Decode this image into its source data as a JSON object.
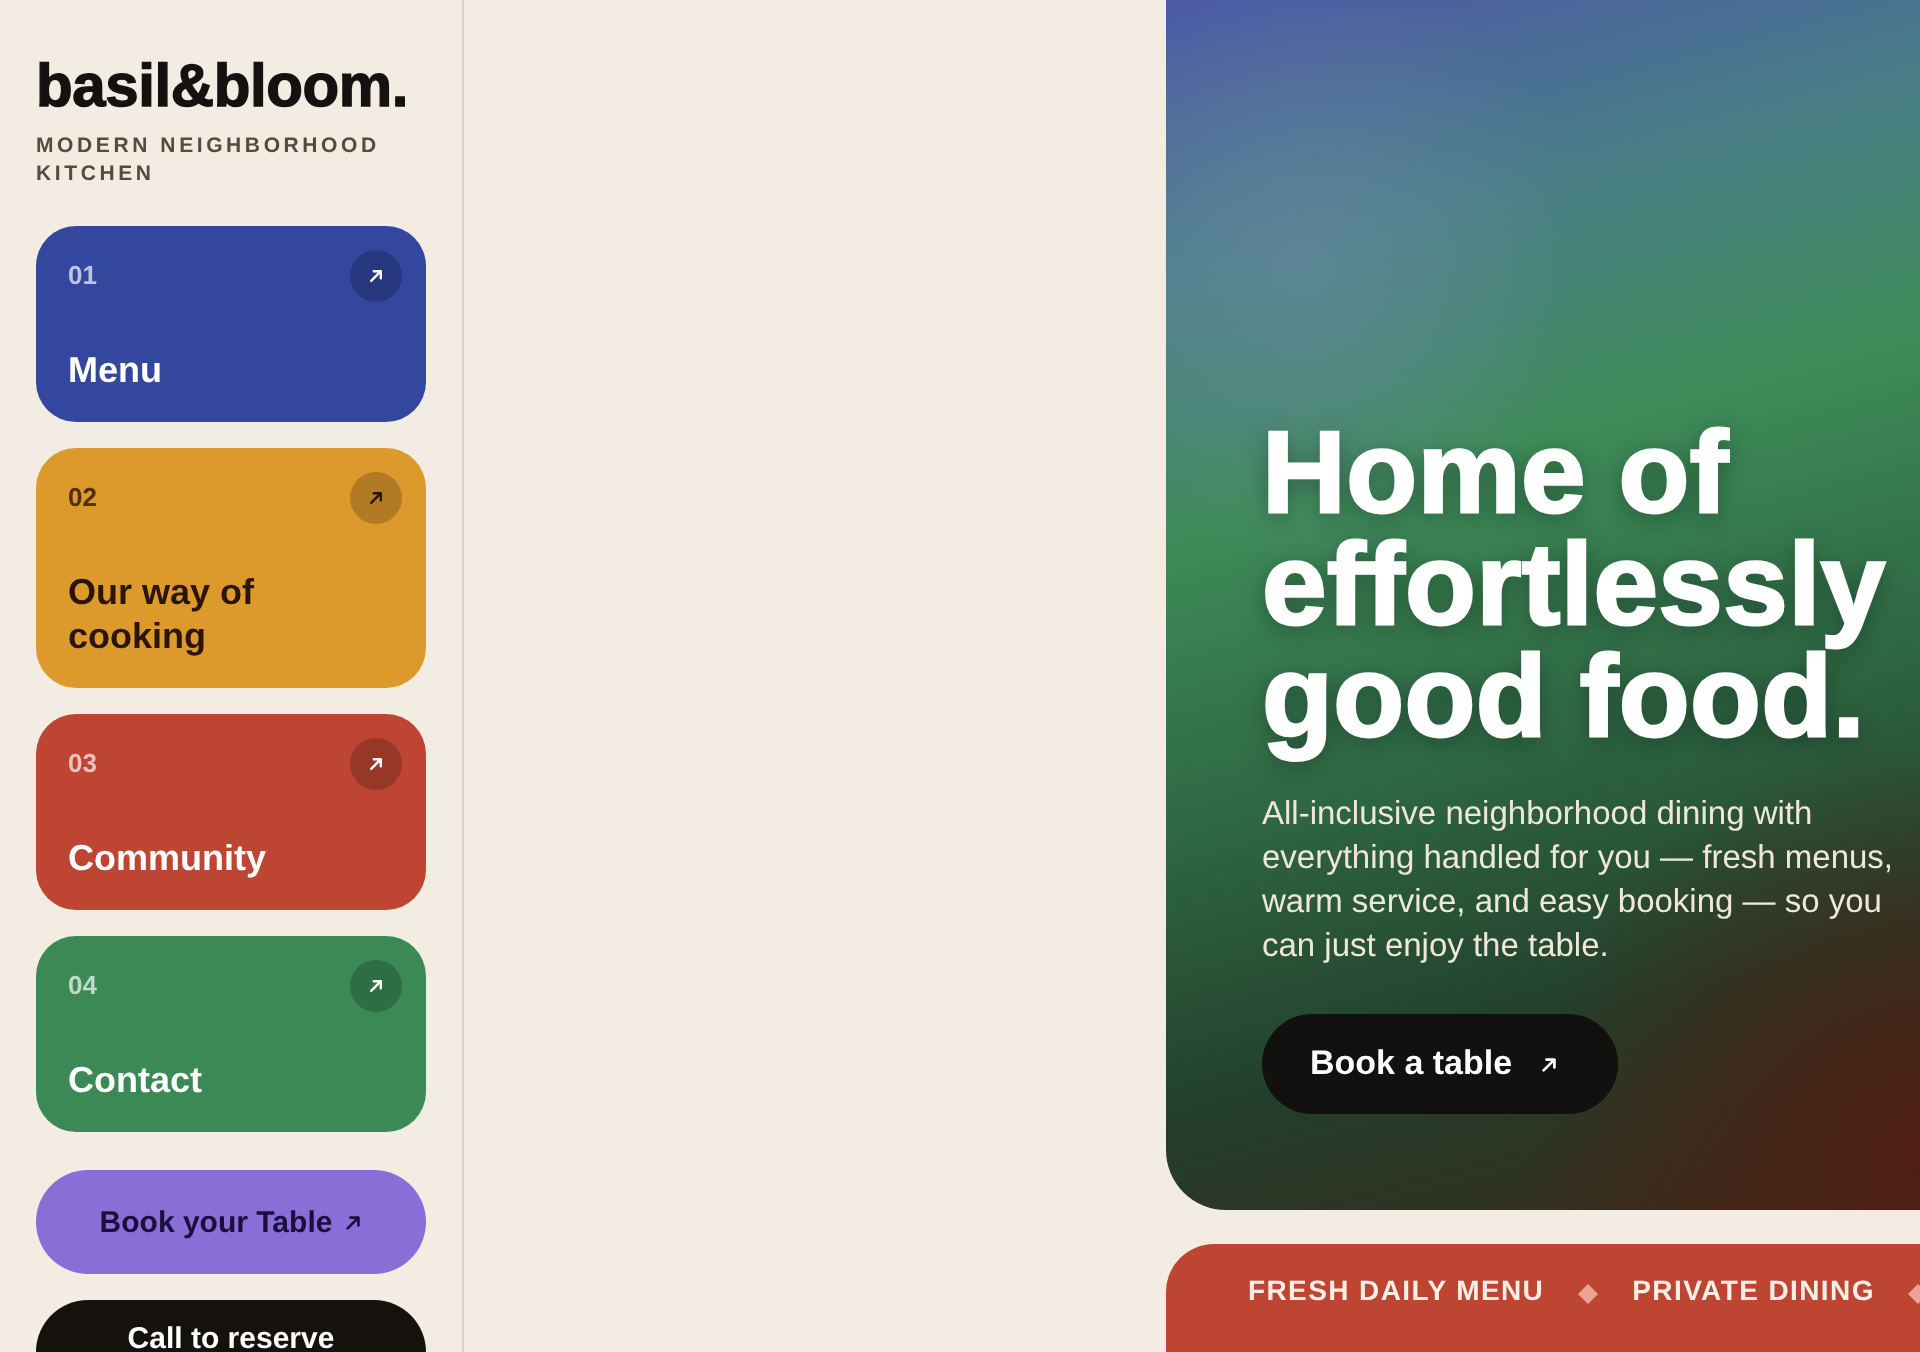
{
  "brand": {
    "name": "basil&bloom.",
    "tagline": "MODERN NEIGHBORHOOD KITCHEN"
  },
  "nav": [
    {
      "number": "01",
      "label": "Menu",
      "color": "#33479f"
    },
    {
      "number": "02",
      "label": "Our way of cooking",
      "color": "#dc9a2d"
    },
    {
      "number": "03",
      "label": "Community",
      "color": "#bd4531"
    },
    {
      "number": "04",
      "label": "Contact",
      "color": "#3b8a55"
    }
  ],
  "actions": [
    {
      "kind": "primary",
      "label": "Book your Table"
    },
    {
      "kind": "dark",
      "label": "Call to reserve"
    }
  ],
  "hero": {
    "headline": "Home of effortlessly good food.",
    "description": "All-inclusive neighborhood dining with everything handled for you — fresh menus, warm service, and easy booking — so you can just enjoy the table.",
    "button": "Book a table"
  },
  "ticker": {
    "items": [
      "FRESH DAILY MENU",
      "PRIVATE DINING"
    ]
  }
}
